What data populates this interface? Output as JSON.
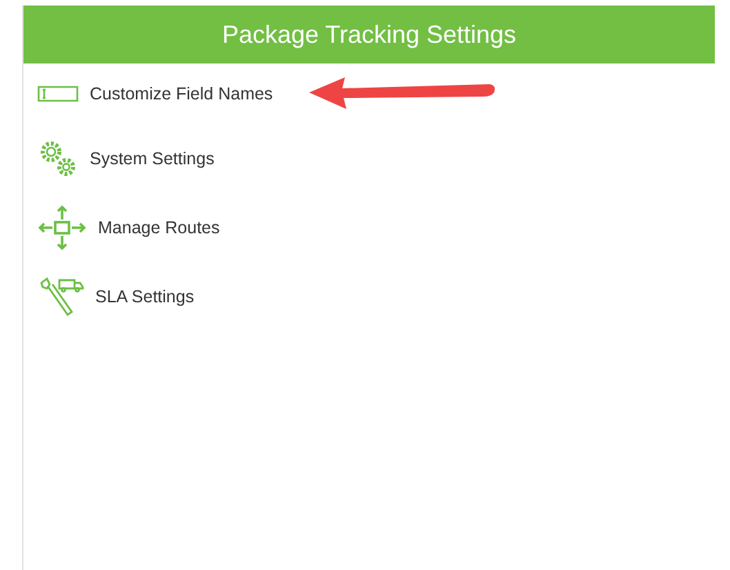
{
  "header": {
    "title": "Package Tracking Settings"
  },
  "items": [
    {
      "kind": "field",
      "label": "Customize Field Names",
      "pointed": true
    },
    {
      "kind": "gears",
      "label": "System Settings",
      "pointed": false
    },
    {
      "kind": "routes",
      "label": "Manage Routes",
      "pointed": false
    },
    {
      "kind": "sla",
      "label": "SLA Settings",
      "pointed": false
    }
  ]
}
